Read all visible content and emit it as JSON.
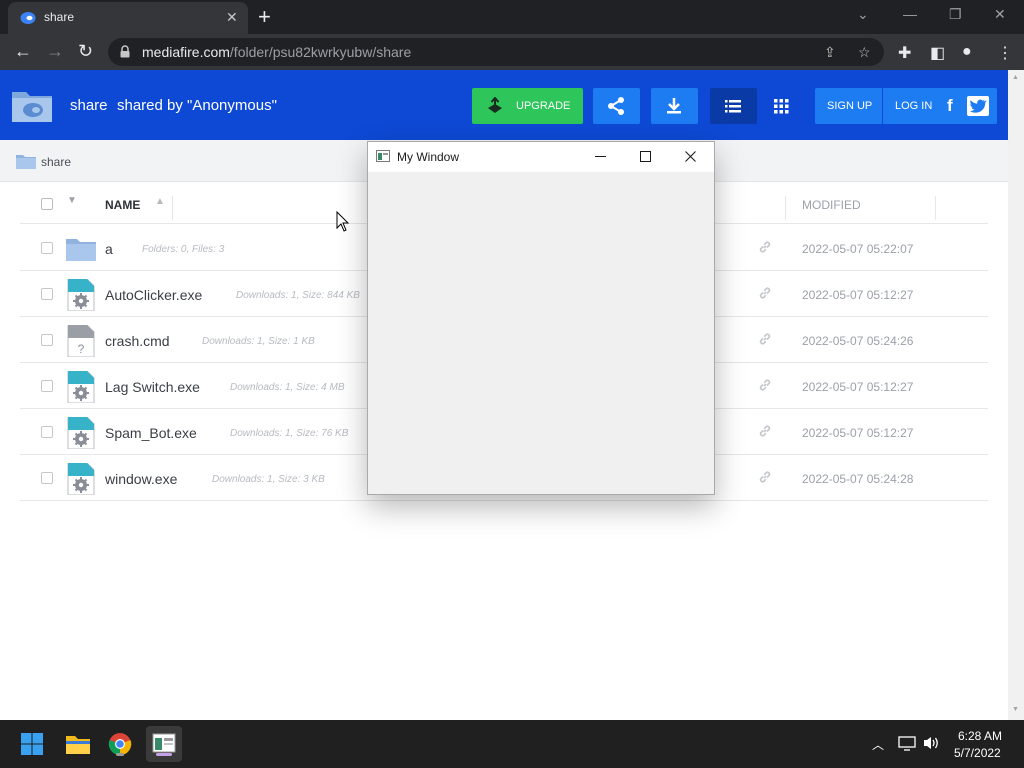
{
  "browser": {
    "tab_title": "share",
    "url_host": "mediafire.com",
    "url_path": "/folder/psu82kwrkyubw/share"
  },
  "header": {
    "folder_name": "share",
    "shared_by": "shared by \"Anonymous\"",
    "upgrade_label": "UPGRADE",
    "signup_label": "SIGN UP",
    "login_label": "LOG IN"
  },
  "breadcrumb": {
    "label": "share"
  },
  "table": {
    "col_name": "NAME",
    "col_modified": "MODIFIED",
    "rows": [
      {
        "name": "a",
        "meta": "Folders: 0, Files: 3",
        "date": "2022-05-07 05:22:07",
        "icon": "folder-icon"
      },
      {
        "name": "AutoClicker.exe",
        "meta": "Downloads: 1, Size: 844 KB",
        "date": "2022-05-07 05:12:27",
        "icon": "exe-file-icon"
      },
      {
        "name": "crash.cmd",
        "meta": "Downloads: 1, Size: 1 KB",
        "date": "2022-05-07 05:24:26",
        "icon": "unknown-file-icon"
      },
      {
        "name": "Lag Switch.exe",
        "meta": "Downloads: 1, Size: 4 MB",
        "date": "2022-05-07 05:12:27",
        "icon": "exe-file-icon"
      },
      {
        "name": "Spam_Bot.exe",
        "meta": "Downloads: 1, Size: 76 KB",
        "date": "2022-05-07 05:12:27",
        "icon": "exe-file-icon"
      },
      {
        "name": "window.exe",
        "meta": "Downloads: 1, Size: 3 KB",
        "date": "2022-05-07 05:24:28",
        "icon": "exe-file-icon"
      }
    ]
  },
  "popup_window": {
    "title": "My Window"
  },
  "taskbar": {
    "time": "6:28 AM",
    "date": "5/7/2022"
  },
  "colors": {
    "header_bg": "#0d49d4",
    "upgrade_green": "#2ec55a",
    "button_blue": "#1e7cf2"
  }
}
